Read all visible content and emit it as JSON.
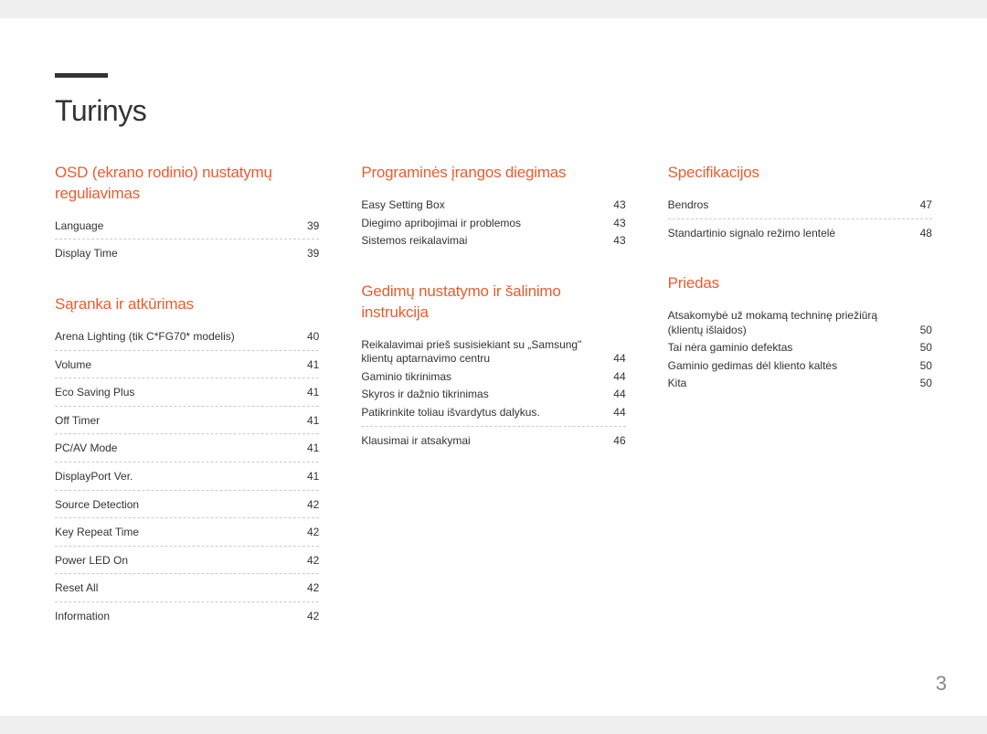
{
  "pageTitle": "Turinys",
  "pageNumber": "3",
  "columns": [
    {
      "sections": [
        {
          "title": "OSD (ekrano rodinio) nustatymų reguliavimas",
          "groups": [
            {
              "rule": true,
              "entries": [
                {
                  "label": "Language",
                  "page": "39"
                }
              ]
            },
            {
              "rule": false,
              "entries": [
                {
                  "label": "Display Time",
                  "page": "39"
                }
              ]
            }
          ]
        },
        {
          "title": "Sąranka ir atkūrimas",
          "groups": [
            {
              "rule": true,
              "entries": [
                {
                  "label": "Arena Lighting (tik C*FG70* modelis)",
                  "page": "40"
                }
              ]
            },
            {
              "rule": true,
              "entries": [
                {
                  "label": "Volume",
                  "page": "41"
                }
              ]
            },
            {
              "rule": true,
              "entries": [
                {
                  "label": "Eco Saving Plus",
                  "page": "41"
                }
              ]
            },
            {
              "rule": true,
              "entries": [
                {
                  "label": "Off Timer",
                  "page": "41"
                }
              ]
            },
            {
              "rule": true,
              "entries": [
                {
                  "label": "PC/AV Mode",
                  "page": "41"
                }
              ]
            },
            {
              "rule": true,
              "entries": [
                {
                  "label": "DisplayPort Ver.",
                  "page": "41"
                }
              ]
            },
            {
              "rule": true,
              "entries": [
                {
                  "label": "Source Detection",
                  "page": "42"
                }
              ]
            },
            {
              "rule": true,
              "entries": [
                {
                  "label": "Key Repeat Time",
                  "page": "42"
                }
              ]
            },
            {
              "rule": true,
              "entries": [
                {
                  "label": "Power LED On",
                  "page": "42"
                }
              ]
            },
            {
              "rule": true,
              "entries": [
                {
                  "label": "Reset All",
                  "page": "42"
                }
              ]
            },
            {
              "rule": false,
              "entries": [
                {
                  "label": "Information",
                  "page": "42"
                }
              ]
            }
          ]
        }
      ]
    },
    {
      "sections": [
        {
          "title": "Programinės įrangos diegimas",
          "groups": [
            {
              "rule": false,
              "entries": [
                {
                  "label": "Easy Setting Box",
                  "page": "43"
                },
                {
                  "label": "Diegimo apribojimai ir problemos",
                  "page": "43"
                },
                {
                  "label": "Sistemos reikalavimai",
                  "page": "43"
                }
              ]
            }
          ]
        },
        {
          "title": "Gedimų nustatymo ir šalinimo instrukcija",
          "groups": [
            {
              "rule": true,
              "entries": [
                {
                  "label": "Reikalavimai prieš susisiekiant su „Samsung\" klientų aptarnavimo centru",
                  "page": "44"
                },
                {
                  "label": "Gaminio tikrinimas",
                  "page": "44"
                },
                {
                  "label": "Skyros ir dažnio tikrinimas",
                  "page": "44"
                },
                {
                  "label": "Patikrinkite toliau išvardytus dalykus.",
                  "page": "44"
                }
              ]
            },
            {
              "rule": false,
              "entries": [
                {
                  "label": "Klausimai ir atsakymai",
                  "page": "46"
                }
              ]
            }
          ]
        }
      ]
    },
    {
      "sections": [
        {
          "title": "Specifikacijos",
          "groups": [
            {
              "rule": true,
              "entries": [
                {
                  "label": "Bendros",
                  "page": "47"
                }
              ]
            },
            {
              "rule": false,
              "entries": [
                {
                  "label": "Standartinio signalo režimo lentelė",
                  "page": "48"
                }
              ]
            }
          ]
        },
        {
          "title": "Priedas",
          "groups": [
            {
              "rule": false,
              "entries": [
                {
                  "label": "Atsakomybė už mokamą techninę priežiūrą (klientų išlaidos)",
                  "page": "50"
                },
                {
                  "label": "Tai nėra gaminio defektas",
                  "page": "50"
                },
                {
                  "label": "Gaminio gedimas dėl kliento kaltės",
                  "page": "50"
                },
                {
                  "label": "Kita",
                  "page": "50"
                }
              ]
            }
          ]
        }
      ]
    }
  ]
}
